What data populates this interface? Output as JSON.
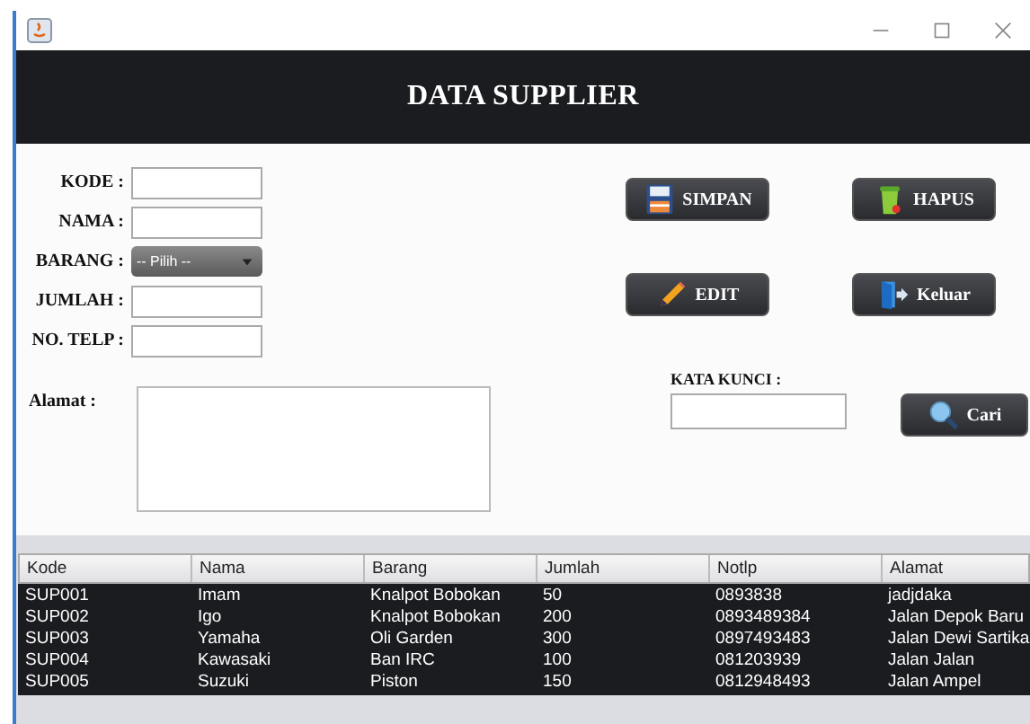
{
  "header": {
    "title": "DATA SUPPLIER"
  },
  "form": {
    "fields": [
      {
        "label": "KODE :",
        "kind": "text"
      },
      {
        "label": "NAMA :",
        "kind": "text"
      },
      {
        "label": "BARANG :",
        "kind": "select",
        "value": "-- Pilih --"
      },
      {
        "label": "JUMLAH :",
        "kind": "text"
      },
      {
        "label": "NO. TELP :",
        "kind": "text"
      },
      {
        "label": "Alamat :",
        "kind": "textarea"
      }
    ]
  },
  "buttons": [
    {
      "label": "SIMPAN",
      "kind": "save"
    },
    {
      "label": "HAPUS",
      "kind": "delete"
    },
    {
      "label": "EDIT",
      "kind": "edit"
    },
    {
      "label": "Keluar",
      "kind": "exit"
    }
  ],
  "search": {
    "label": "KATA KUNCI :",
    "button": "Cari"
  },
  "table": {
    "columns": [
      "Kode",
      "Nama",
      "Barang",
      "Jumlah",
      "Notlp",
      "Alamat"
    ],
    "rows": [
      [
        "SUP001",
        "Imam",
        "Knalpot Bobokan",
        "50",
        "0893838",
        "jadjdaka"
      ],
      [
        "SUP002",
        "Igo",
        "Knalpot Bobokan",
        "200",
        "0893489384",
        "Jalan Depok Baru"
      ],
      [
        "SUP003",
        "Yamaha",
        "Oli Garden",
        "300",
        "0897493483",
        "Jalan Dewi Sartika"
      ],
      [
        "SUP004",
        "Kawasaki",
        "Ban IRC",
        "100",
        "081203939",
        "Jalan Jalan"
      ],
      [
        "SUP005",
        "Suzuki",
        "Piston",
        "150",
        "0812948493",
        "Jalan Ampel"
      ]
    ]
  }
}
